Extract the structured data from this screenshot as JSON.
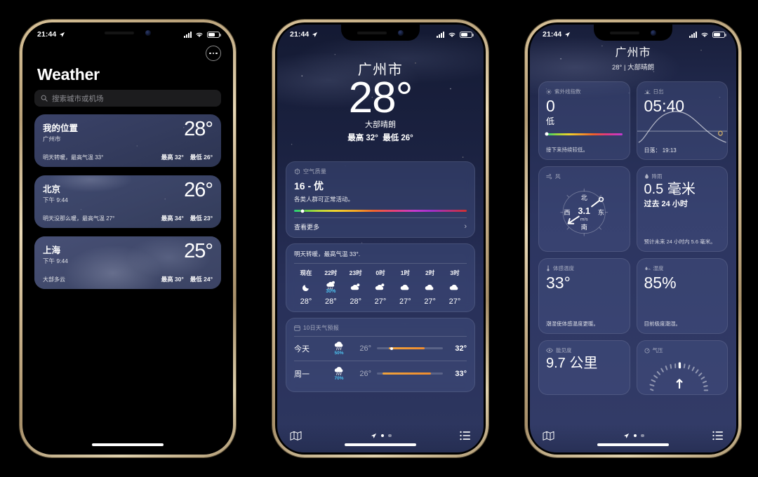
{
  "status_bar": {
    "time": "21:44",
    "location_icon": "location-arrow-icon",
    "battery_pct": 62
  },
  "phone1": {
    "title": "Weather",
    "menu_icon": "more-circle-icon",
    "search": {
      "icon": "search-icon",
      "placeholder": "搜索城市或机场",
      "value": ""
    },
    "cities": [
      {
        "name": "我的位置",
        "sub": "广州市",
        "temp": "28°",
        "desc": "明天转暖，最高气温 33°",
        "high": "最高 32°",
        "low": "最低 26°"
      },
      {
        "name": "北京",
        "sub": "下午 9:44",
        "temp": "26°",
        "desc": "明天没那么暖，最高气温 27°",
        "high": "最高 34°",
        "low": "最低 23°"
      },
      {
        "name": "上海",
        "sub": "下午 9:44",
        "temp": "25°",
        "desc": "大部多云",
        "high": "最高 30°",
        "low": "最低 24°"
      }
    ]
  },
  "phone2": {
    "hero": {
      "city": "广州市",
      "temp": "28°",
      "condition": "大部晴朗",
      "high": "最高 32°",
      "low": "最低 26°"
    },
    "air_quality": {
      "icon": "air-quality-icon",
      "label": "空气质量",
      "value": "16 - 优",
      "description": "各类人群可正常活动。",
      "scale_pos_pct": 5,
      "more_label": "查看更多",
      "chevron": "chevron-right-icon"
    },
    "hourly": {
      "summary": "明天转暖，最高气温 33°.",
      "items": [
        {
          "time": "现在",
          "icon": "moon-icon",
          "pop": "",
          "temp": "28°"
        },
        {
          "time": "22时",
          "icon": "rain-moon-icon",
          "pop": "30%",
          "temp": "28°"
        },
        {
          "time": "23时",
          "icon": "cloud-moon-icon",
          "pop": "",
          "temp": "28°"
        },
        {
          "time": "0时",
          "icon": "cloud-moon-icon",
          "pop": "",
          "temp": "27°"
        },
        {
          "time": "1时",
          "icon": "cloud-icon",
          "pop": "",
          "temp": "27°"
        },
        {
          "time": "2时",
          "icon": "cloud-icon",
          "pop": "",
          "temp": "27°"
        },
        {
          "time": "3时",
          "icon": "cloud-icon",
          "pop": "",
          "temp": "27°"
        }
      ]
    },
    "daily": {
      "icon": "calendar-icon",
      "label": "10日天气预报",
      "rows": [
        {
          "day": "今天",
          "icon": "rain-icon",
          "pop": "50%",
          "lo": "26°",
          "hi": "32°",
          "bar_start_pct": 18,
          "bar_end_pct": 72,
          "now_pct": 22
        },
        {
          "day": "周一",
          "icon": "rain-icon",
          "pop": "70%",
          "lo": "26°",
          "hi": "33°",
          "bar_start_pct": 8,
          "bar_end_pct": 82,
          "now_pct": -1
        }
      ]
    },
    "tabbar": {
      "map_icon": "map-icon",
      "list_icon": "list-icon",
      "location_icon": "location-arrow-icon",
      "page_index": 1,
      "page_count": 3
    }
  },
  "phone3": {
    "header": {
      "city": "广州市",
      "summary": "28° | 大部晴朗"
    },
    "cards": [
      {
        "icon": "uv-icon",
        "label": "紫外线指数",
        "value": "0",
        "sub": "低",
        "footer": "接下来持续较低。",
        "kind": "uv",
        "scale_pos_pct": 1
      },
      {
        "icon": "sunrise-icon",
        "label": "日出",
        "value": "05:40",
        "sub": "",
        "footer": "日落： 19:13",
        "kind": "sun"
      },
      {
        "icon": "wind-icon",
        "label": "风",
        "value": "3.1",
        "sub": "m/s",
        "footer": "",
        "kind": "wind",
        "compass": {
          "n": "北",
          "e": "东",
          "s": "南",
          "w": "西"
        }
      },
      {
        "icon": "rain-drop-icon",
        "label": "降雨",
        "value": "0.5 毫米",
        "sub": "过去 24 小时",
        "footer": "预计未来 24 小时内 5.6 毫米。",
        "kind": "text"
      },
      {
        "icon": "thermometer-icon",
        "label": "体感温度",
        "value": "33°",
        "sub": "",
        "footer": "潮湿使体感温度更暖。",
        "kind": "text"
      },
      {
        "icon": "humidity-icon",
        "label": "湿度",
        "value": "85%",
        "sub": "",
        "footer": "目前极度潮湿。",
        "kind": "text"
      },
      {
        "icon": "eye-icon",
        "label": "能见度",
        "value": "9.7 公里",
        "sub": "",
        "footer": "",
        "kind": "text"
      },
      {
        "icon": "pressure-icon",
        "label": "气压",
        "value": "",
        "sub": "",
        "footer": "",
        "kind": "gauge"
      }
    ],
    "tabbar": {
      "map_icon": "map-icon",
      "list_icon": "list-icon",
      "location_icon": "location-arrow-icon",
      "page_index": 1,
      "page_count": 3
    }
  }
}
